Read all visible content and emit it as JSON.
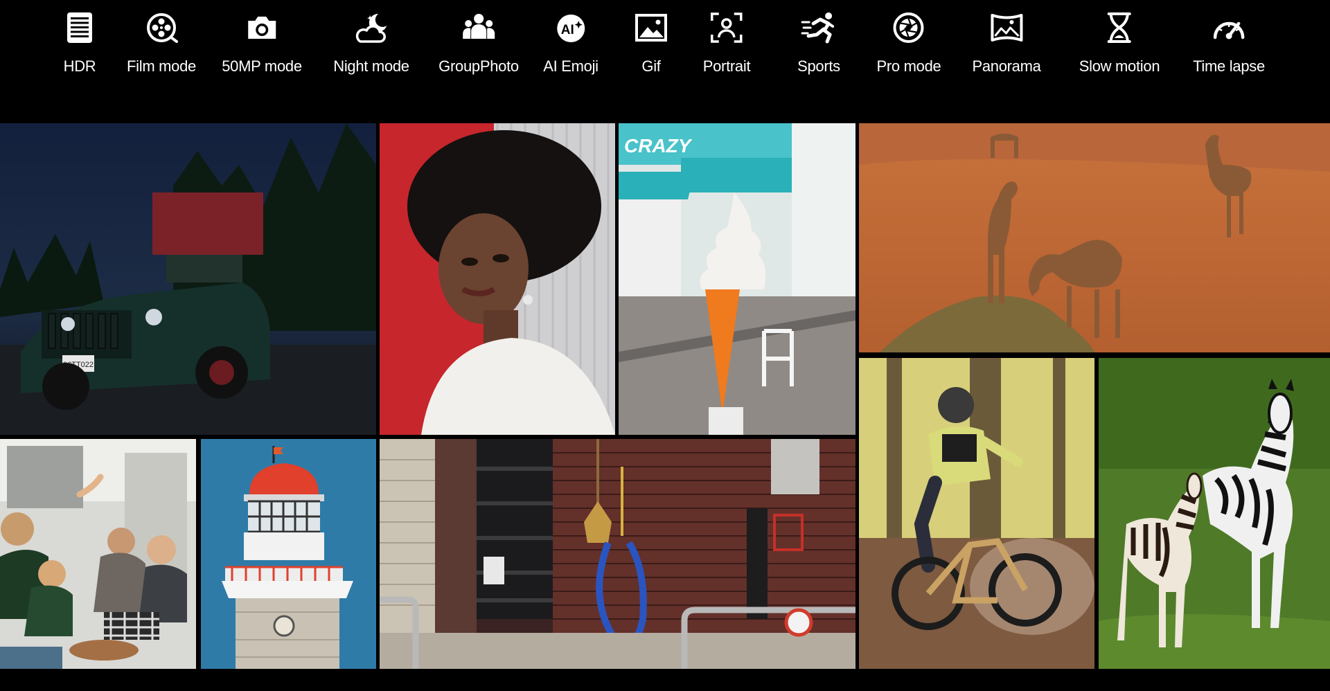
{
  "modes": [
    {
      "label": "HDR",
      "icon": "hdr-icon"
    },
    {
      "label": "Film mode",
      "icon": "film-reel-icon"
    },
    {
      "label": "50MP mode",
      "icon": "camera-icon"
    },
    {
      "label": "Night mode",
      "icon": "moon-cloud-icon"
    },
    {
      "label": "GroupPhoto",
      "icon": "group-people-icon"
    },
    {
      "label": "AI Emoji",
      "icon": "ai-sparkle-icon"
    },
    {
      "label": "Gif",
      "icon": "image-icon"
    },
    {
      "label": "Portrait",
      "icon": "portrait-focus-icon"
    },
    {
      "label": "Sports",
      "icon": "running-person-icon"
    },
    {
      "label": "Pro mode",
      "icon": "aperture-icon"
    },
    {
      "label": "Panorama",
      "icon": "panorama-icon"
    },
    {
      "label": "Slow motion",
      "icon": "hourglass-icon"
    },
    {
      "label": "Time lapse",
      "icon": "speedometer-icon"
    }
  ],
  "photos": [
    {
      "subject": "jeep-night",
      "plate": "96TT022"
    },
    {
      "subject": "woman-portrait"
    },
    {
      "subject": "ice-cream-street",
      "sign": "CRAZY"
    },
    {
      "subject": "camels-desert"
    },
    {
      "subject": "friends-laughing"
    },
    {
      "subject": "lighthouse"
    },
    {
      "subject": "brick-wall-street"
    },
    {
      "subject": "mountain-biker"
    },
    {
      "subject": "zebras"
    }
  ],
  "colors": {
    "background": "#000000",
    "text": "#ffffff"
  }
}
